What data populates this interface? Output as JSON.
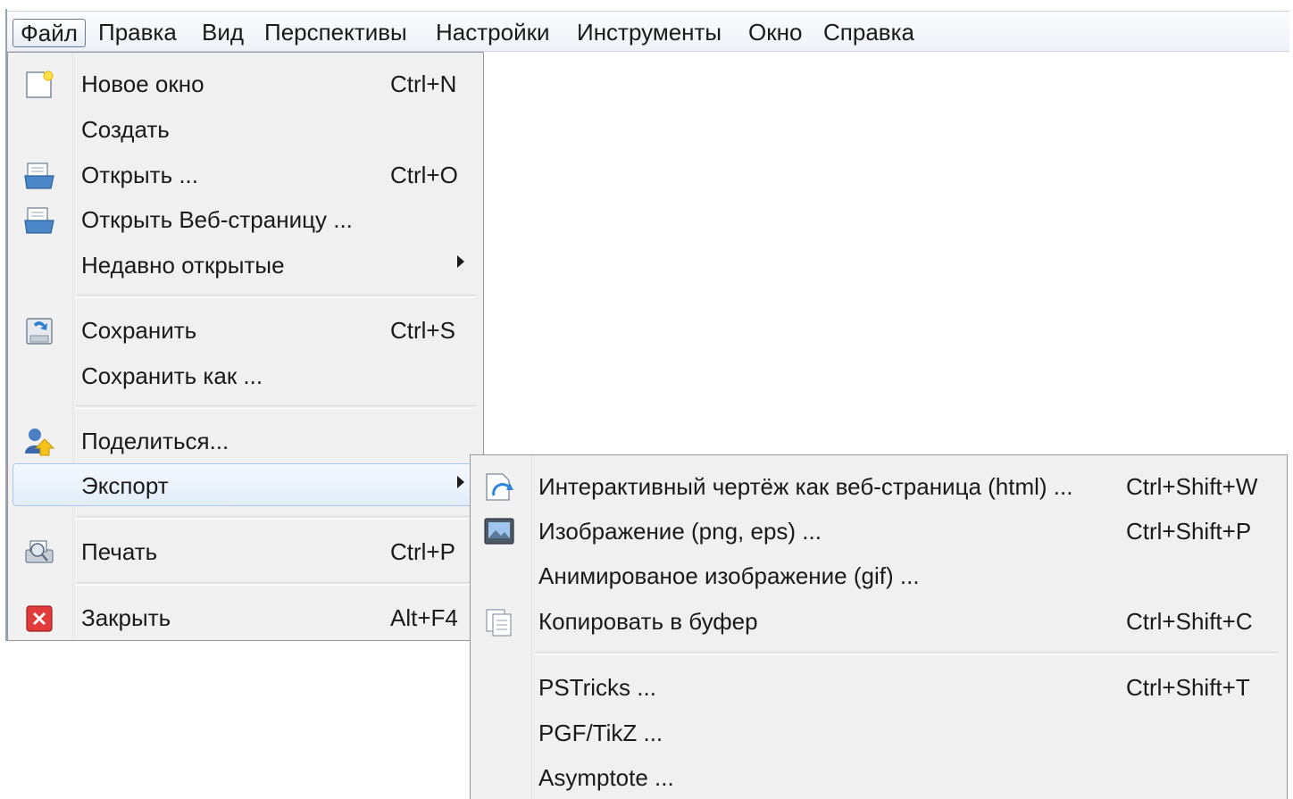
{
  "menubar": {
    "items": [
      "Файл",
      "Правка",
      "Вид",
      "Перспективы",
      "Настройки",
      "Инструменты",
      "Окно",
      "Справка"
    ]
  },
  "file_menu": {
    "items": [
      {
        "label": "Новое окно",
        "shortcut": "Ctrl+N",
        "icon": "new-window-icon"
      },
      {
        "label": "Создать",
        "shortcut": "",
        "icon": ""
      },
      {
        "label": "Открыть ...",
        "shortcut": "Ctrl+O",
        "icon": "open-folder-icon"
      },
      {
        "label": "Открыть Веб-страницу ...",
        "shortcut": "",
        "icon": "open-web-page-icon"
      },
      {
        "label": "Недавно открытые",
        "shortcut": "",
        "icon": "",
        "submenu": true
      },
      {
        "label": "Сохранить",
        "shortcut": "Ctrl+S",
        "icon": "save-icon"
      },
      {
        "label": "Сохранить как ...",
        "shortcut": "",
        "icon": ""
      },
      {
        "label": "Поделиться...",
        "shortcut": "",
        "icon": "share-icon"
      },
      {
        "label": "Экспорт",
        "shortcut": "",
        "icon": "",
        "submenu": true,
        "highlighted": true
      },
      {
        "label": "Печать",
        "shortcut": "Ctrl+P",
        "icon": "print-preview-icon"
      },
      {
        "label": "Закрыть",
        "shortcut": "Alt+F4",
        "icon": "close-icon"
      }
    ]
  },
  "export_menu": {
    "items": [
      {
        "label": "Интерактивный чертёж как веб-страница (html) ...",
        "shortcut": "Ctrl+Shift+W",
        "icon": "html-export-icon"
      },
      {
        "label": "Изображение (png, eps) ...",
        "shortcut": "Ctrl+Shift+P",
        "icon": "image-icon"
      },
      {
        "label": "Анимированое изображение (gif) ...",
        "shortcut": "",
        "icon": ""
      },
      {
        "label": "Копировать в буфер",
        "shortcut": "Ctrl+Shift+C",
        "icon": "copy-icon"
      },
      {
        "label": "PSTricks ...",
        "shortcut": "Ctrl+Shift+T",
        "icon": ""
      },
      {
        "label": "PGF/TikZ ...",
        "shortcut": "",
        "icon": ""
      },
      {
        "label": "Asymptote ...",
        "shortcut": "",
        "icon": ""
      }
    ]
  },
  "colors": {
    "menu_background": "#f0f0f0",
    "highlight_border": "#a8c8ec",
    "text": "#1a1a1a"
  }
}
